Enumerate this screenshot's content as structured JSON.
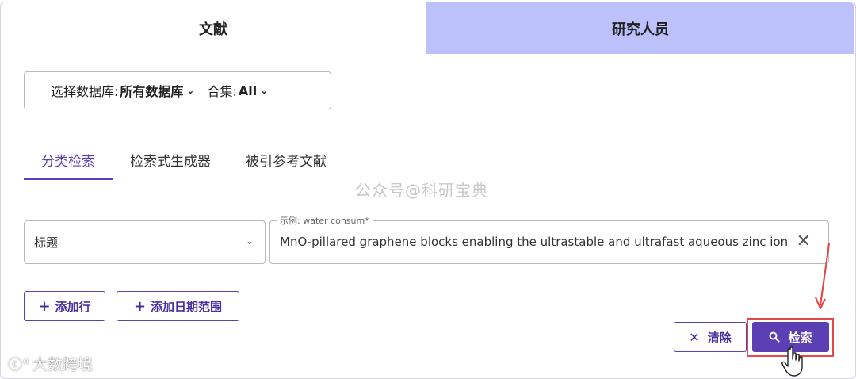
{
  "tabs": {
    "literature": "文献",
    "researchers": "研究人员"
  },
  "database_selector": {
    "db_label": "选择数据库:",
    "db_value": "所有数据库",
    "collection_label": "合集:",
    "collection_value": "All"
  },
  "subtabs": [
    "分类检索",
    "检索式生成器",
    "被引参考文献"
  ],
  "watermark": "公众号@科研宝典",
  "search_row": {
    "field_value": "标题",
    "example_label": "示例: water consum*",
    "query_value": "MnO-pillared graphene blocks enabling the ultrastable and ultrafast aqueous zinc ion batt"
  },
  "buttons": {
    "add_row": "添加行",
    "add_date_range": "添加日期范围",
    "clear": "清除",
    "search": "检索"
  },
  "logo_watermark": "大数跨境",
  "colors": {
    "accent": "#5b3fb3",
    "inactive_tab": "#bcc0fb",
    "highlight": "#e24a4a"
  }
}
